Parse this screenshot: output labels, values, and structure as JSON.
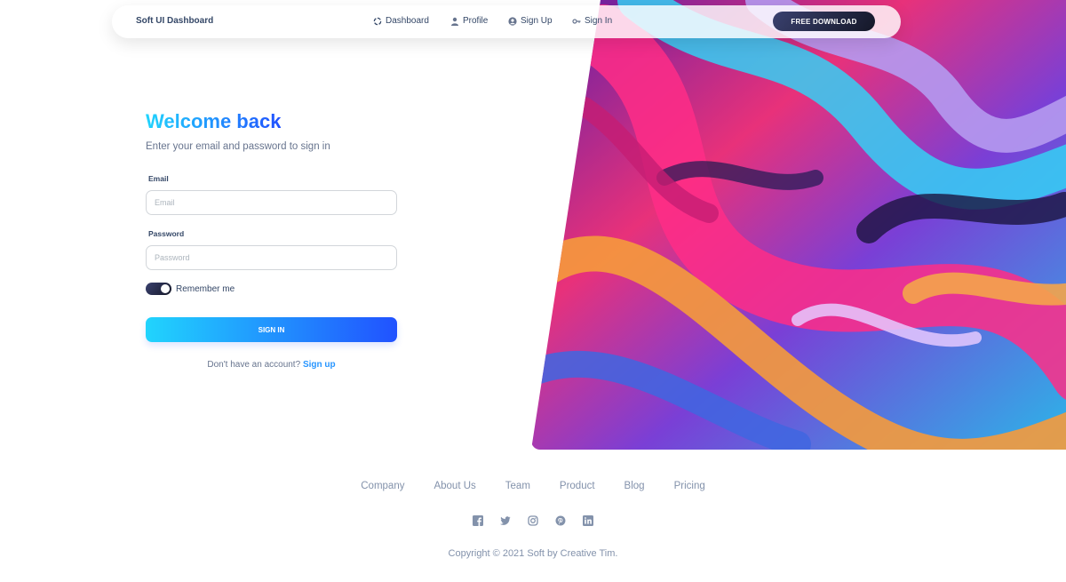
{
  "navbar": {
    "brand": "Soft UI Dashboard",
    "links": [
      {
        "label": "Dashboard",
        "icon": "dashboard-icon"
      },
      {
        "label": "Profile",
        "icon": "user-icon"
      },
      {
        "label": "Sign Up",
        "icon": "user-circle-icon"
      },
      {
        "label": "Sign In",
        "icon": "key-icon"
      }
    ],
    "download_label": "FREE DOWNLOAD"
  },
  "form": {
    "title": "Welcome back",
    "subtitle": "Enter your email and password to sign in",
    "email_label": "Email",
    "email_placeholder": "Email",
    "password_label": "Password",
    "password_placeholder": "Password",
    "remember_label": "Remember me",
    "remember_checked": true,
    "submit_label": "SIGN IN",
    "no_account_text": "Don't have an account?",
    "signup_link": "Sign up"
  },
  "footer": {
    "links": [
      "Company",
      "About Us",
      "Team",
      "Product",
      "Blog",
      "Pricing"
    ],
    "social_icons": [
      "facebook-icon",
      "twitter-icon",
      "instagram-icon",
      "pinterest-icon",
      "linkedin-icon"
    ],
    "copyright": "Copyright © 2021 Soft by Creative Tim."
  },
  "colors": {
    "gradient_start": "#21d4fd",
    "gradient_end": "#2152ff",
    "dark": "#344767",
    "muted": "#67748e"
  }
}
